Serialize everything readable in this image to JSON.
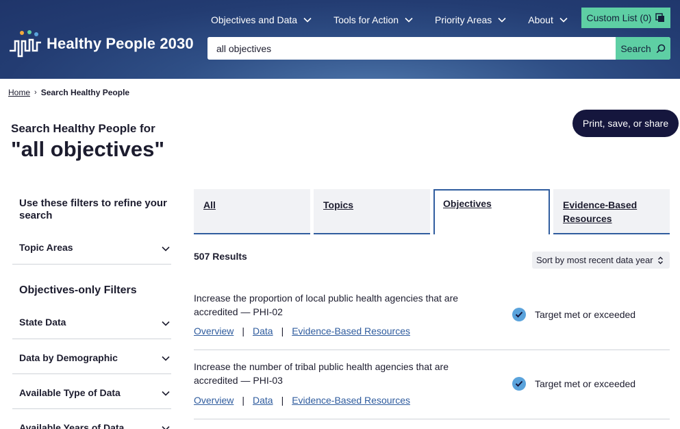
{
  "header": {
    "logo_text": "Healthy People 2030",
    "nav": [
      {
        "label": "Objectives and Data"
      },
      {
        "label": "Tools for Action"
      },
      {
        "label": "Priority Areas"
      },
      {
        "label": "About"
      }
    ],
    "custom_list_label": "Custom List (0)",
    "search": {
      "value": "all objectives",
      "button_label": "Search"
    }
  },
  "breadcrumb": {
    "home": "Home",
    "current": "Search Healthy People"
  },
  "page": {
    "pre_title": "Search Healthy People for",
    "title": "\"all objectives\"",
    "share_label": "Print, save, or share"
  },
  "filters": {
    "heading": "Use these filters to refine your search",
    "topic_areas": "Topic Areas",
    "objectives_heading": "Objectives-only Filters",
    "items": [
      "State Data",
      "Data by Demographic",
      "Available Type of Data",
      "Available Years of Data"
    ]
  },
  "tabs": [
    {
      "label": "All"
    },
    {
      "label": "Topics"
    },
    {
      "label": "Objectives"
    },
    {
      "label": "Evidence-Based Resources"
    }
  ],
  "results": {
    "count_label": "507 Results",
    "sort_label": "Sort by most recent data year",
    "items": [
      {
        "description": "Increase the proportion of local public health agencies that are accredited — PHI-02",
        "links": [
          "Overview",
          "Data",
          "Evidence-Based Resources"
        ],
        "status": "Target met or exceeded"
      },
      {
        "description": "Increase the number of tribal public health agencies that are accredited — PHI-03",
        "links": [
          "Overview",
          "Data",
          "Evidence-Based Resources"
        ],
        "status": "Target met or exceeded"
      }
    ]
  },
  "colors": {
    "header_bg": "#233c72",
    "accent_green": "#5ecfa4",
    "share_bg": "#15163d",
    "link_blue": "#2f5c9e",
    "check_blue": "#5aa3dc"
  }
}
